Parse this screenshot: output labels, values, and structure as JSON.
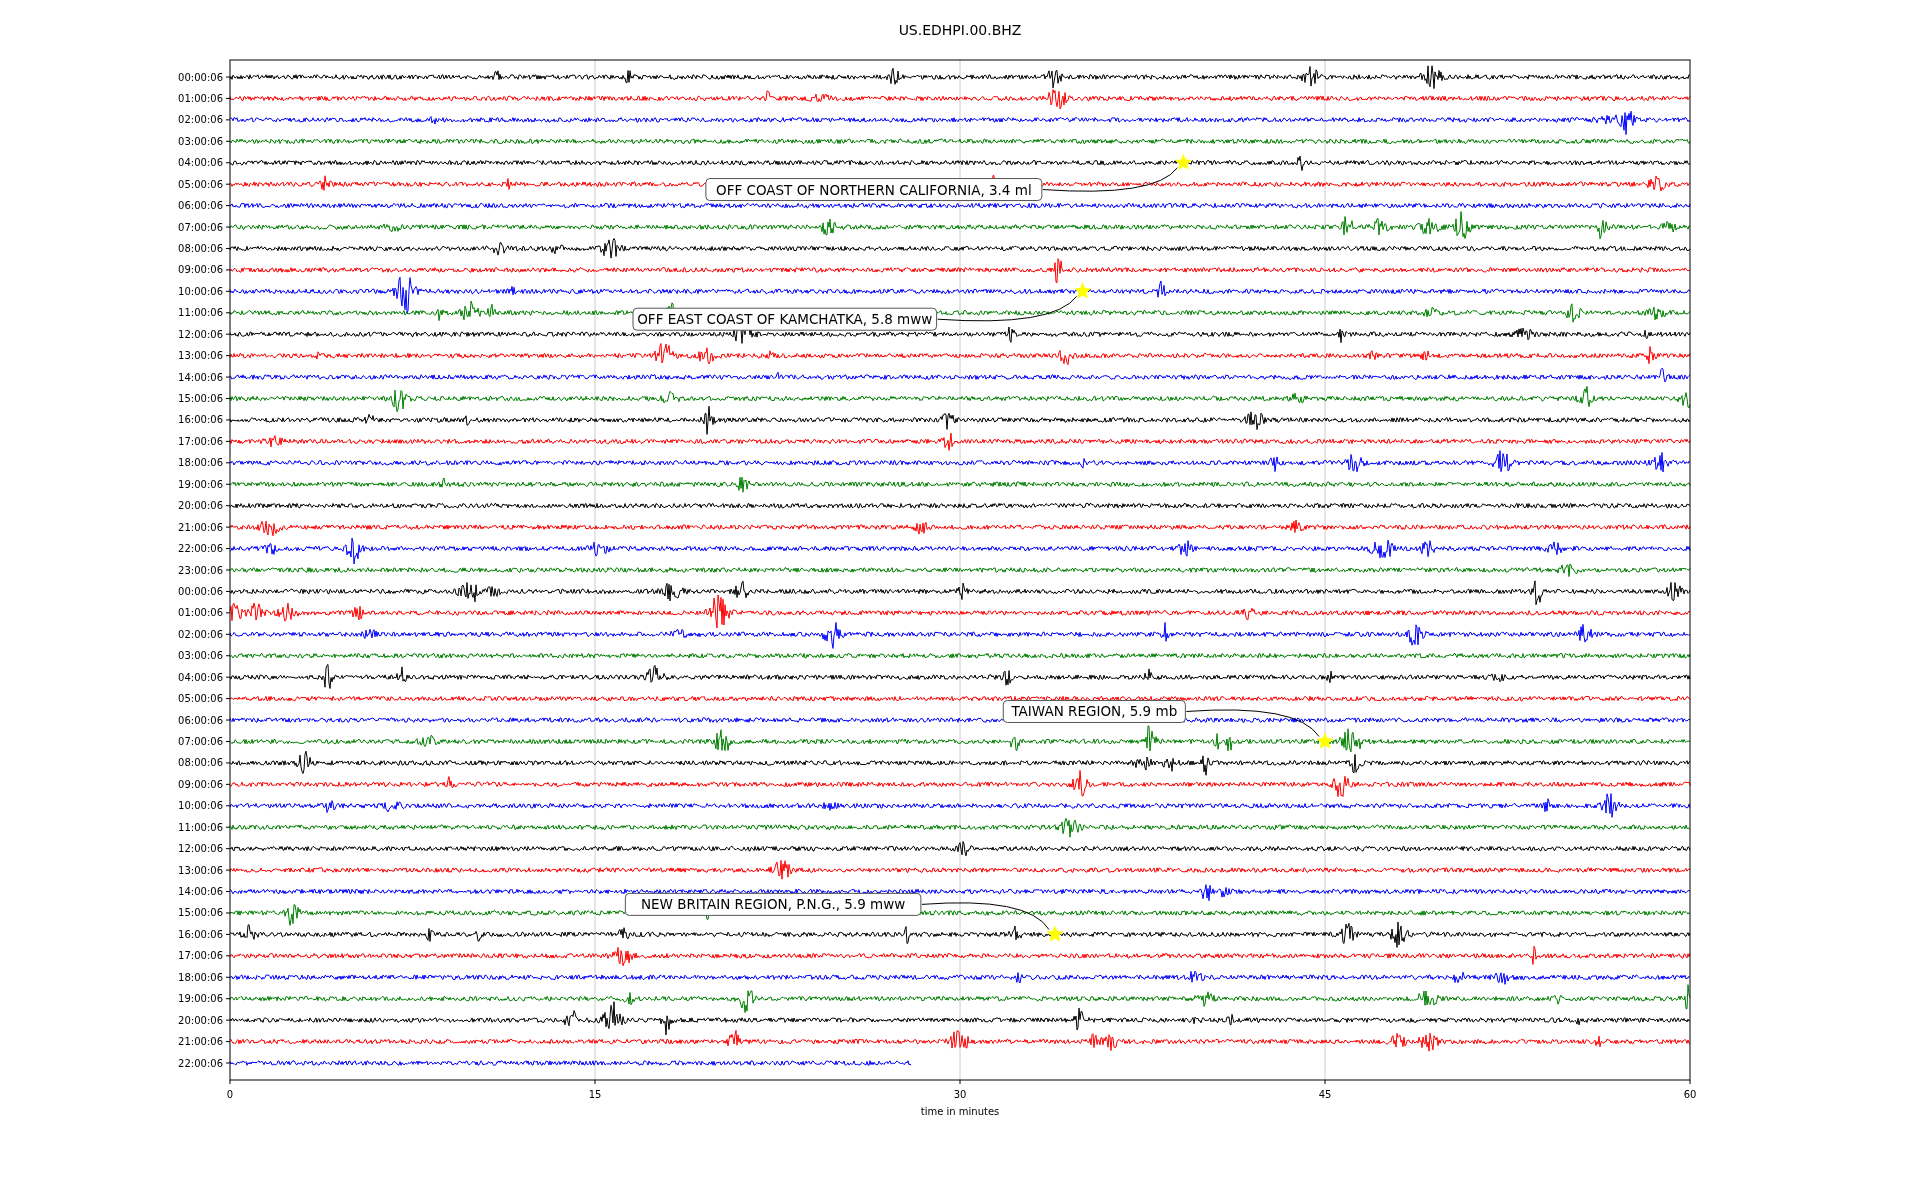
{
  "plot": {
    "title": "US.EDHPI.00.BHZ",
    "row_labels": [
      "00:00:06",
      "01:00:06",
      "02:00:06",
      "03:00:06",
      "04:00:06",
      "05:00:06",
      "06:00:06",
      "07:00:06",
      "08:00:06",
      "09:00:06",
      "10:00:06",
      "11:00:06",
      "12:00:06",
      "13:00:06",
      "14:00:06",
      "15:00:06",
      "16:00:06",
      "17:00:06",
      "18:00:06",
      "19:00:06",
      "20:00:06",
      "21:00:06",
      "22:00:06",
      "23:00:06",
      "00:00:06",
      "01:00:06",
      "02:00:06",
      "03:00:06",
      "04:00:06",
      "05:00:06",
      "06:00:06",
      "07:00:06",
      "08:00:06",
      "09:00:06",
      "10:00:06",
      "11:00:06",
      "12:00:06",
      "13:00:06",
      "14:00:06",
      "15:00:06",
      "16:00:06",
      "17:00:06",
      "18:00:06",
      "19:00:06",
      "20:00:06",
      "21:00:06",
      "22:00:06"
    ],
    "x_ticks": [
      "0",
      "15",
      "30",
      "45",
      "60"
    ],
    "x_label": "time in minutes",
    "traces": [
      {
        "color": "#000000"
      },
      {
        "color": "#ff0000"
      },
      {
        "color": "#0000ff"
      },
      {
        "color": "#008000"
      },
      {
        "color": "#000000"
      },
      {
        "color": "#ff0000"
      },
      {
        "color": "#0000ff"
      },
      {
        "color": "#008000"
      },
      {
        "color": "#000000"
      },
      {
        "color": "#ff0000"
      },
      {
        "color": "#0000ff"
      },
      {
        "color": "#008000"
      },
      {
        "color": "#000000"
      },
      {
        "color": "#ff0000"
      },
      {
        "color": "#0000ff"
      },
      {
        "color": "#008000"
      },
      {
        "color": "#000000"
      },
      {
        "color": "#ff0000"
      },
      {
        "color": "#0000ff"
      },
      {
        "color": "#008000"
      },
      {
        "color": "#000000"
      },
      {
        "color": "#ff0000"
      },
      {
        "color": "#0000ff"
      },
      {
        "color": "#008000"
      },
      {
        "color": "#000000"
      },
      {
        "color": "#ff0000"
      },
      {
        "color": "#0000ff"
      },
      {
        "color": "#008000"
      },
      {
        "color": "#000000"
      },
      {
        "color": "#ff0000"
      },
      {
        "color": "#0000ff"
      },
      {
        "color": "#008000"
      },
      {
        "color": "#000000"
      },
      {
        "color": "#ff0000"
      },
      {
        "color": "#0000ff"
      },
      {
        "color": "#008000"
      },
      {
        "color": "#000000"
      },
      {
        "color": "#ff0000"
      },
      {
        "color": "#0000ff"
      },
      {
        "color": "#008000"
      },
      {
        "color": "#000000"
      },
      {
        "color": "#ff0000"
      },
      {
        "color": "#0000ff"
      },
      {
        "color": "#008000"
      },
      {
        "color": "#000000"
      },
      {
        "color": "#ff0000"
      },
      {
        "color": "#0000ff"
      }
    ],
    "events": [
      {
        "text": "OFF COAST OF NORTHERN CALIFORNIA, 3.4 ml"
      },
      {
        "text": "OFF EAST COAST OF KAMCHATKA, 5.8 mww"
      },
      {
        "text": "TAIWAN REGION, 5.9 mb"
      },
      {
        "text": "NEW BRITAIN REGION, P.N.G., 5.9 mww"
      }
    ]
  }
}
